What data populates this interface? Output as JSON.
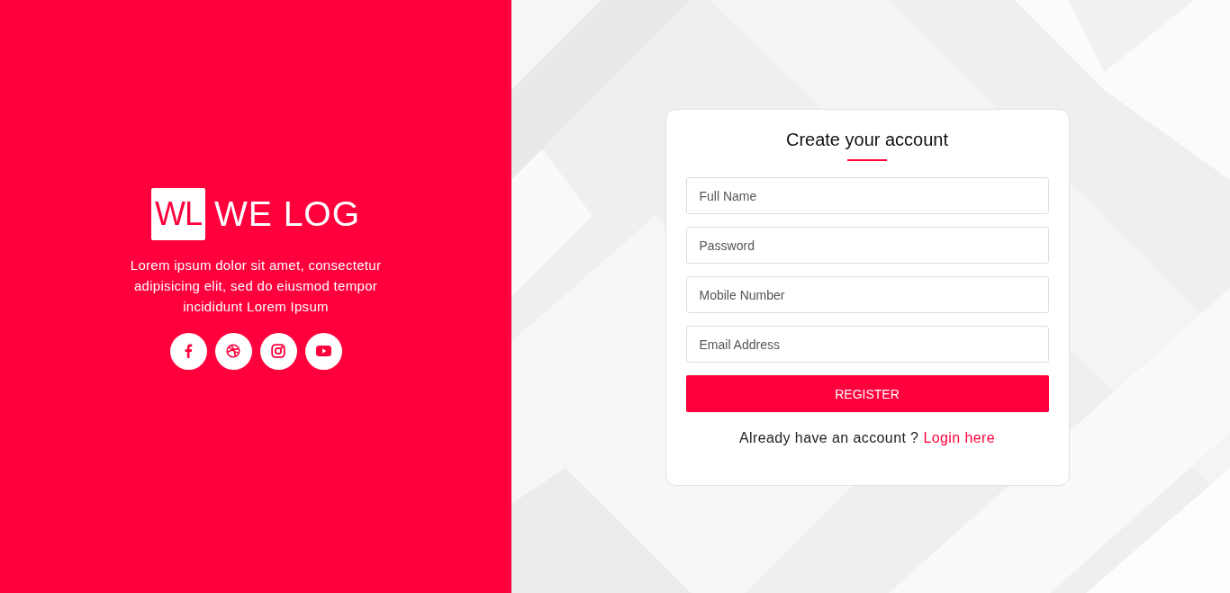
{
  "brand": {
    "mark": "WL",
    "name": "WE LOG"
  },
  "tagline": "Lorem ipsum dolor sit amet, consectetur adipisicing elit, sed do eiusmod tempor incididunt Lorem Ipsum",
  "social": [
    {
      "kind": "facebook"
    },
    {
      "kind": "dribbble"
    },
    {
      "kind": "instagram"
    },
    {
      "kind": "youtube"
    }
  ],
  "form": {
    "title": "Create your account",
    "fields": [
      {
        "placeholder": "Full Name"
      },
      {
        "placeholder": "Password"
      },
      {
        "placeholder": "Mobile Number"
      },
      {
        "placeholder": "Email Address"
      }
    ],
    "submit": "REGISTER",
    "footer": {
      "text": "Already have an account ?",
      "link": "Login here"
    }
  }
}
